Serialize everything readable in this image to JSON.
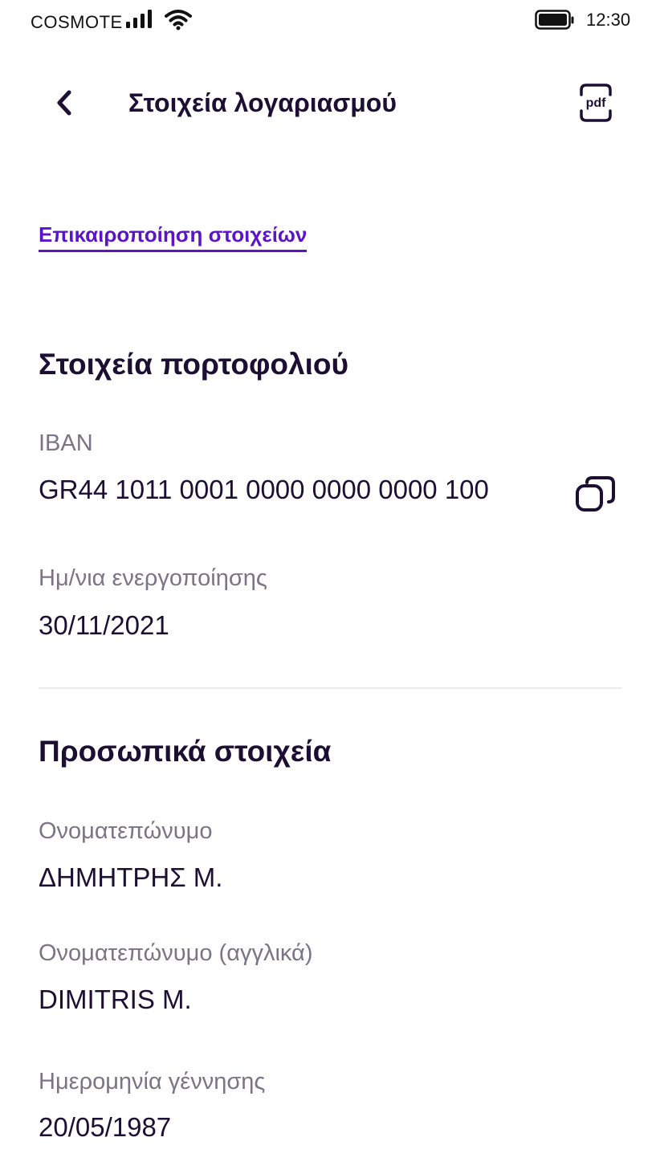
{
  "status_bar": {
    "carrier": "COSMOTE",
    "time": "12:30"
  },
  "header": {
    "title": "Στοιχεία λογαριασμού",
    "pdf_label": "pdf"
  },
  "update_link": "Επικαιροποίηση στοιχείων",
  "portfolio": {
    "title": "Στοιχεία πορτοφολιού",
    "iban_label": "IBAN",
    "iban_value": "GR44 1011 0001 0000 0000 0000 100",
    "activation_label": "Ημ/νια ενεργοποίησης",
    "activation_value": "30/11/2021"
  },
  "personal": {
    "title": "Προσωπικά στοιχεία",
    "name_label": "Ονοματεπώνυμο",
    "name_value": "ΔΗΜΗΤΡΗΣ Μ.",
    "name_en_label": "Ονοματεπώνυμο (αγγλικά)",
    "name_en_value": "DIMITRIS M.",
    "birthdate_label": "Ημερομηνία γέννησης",
    "birthdate_value": "20/05/1987"
  },
  "colors": {
    "primary_text": "#1c0f33",
    "accent": "#5b14c9",
    "secondary_text": "#7c7385",
    "divider": "#ebe8ee"
  },
  "icons": {
    "back": "chevron-left-icon",
    "pdf": "pdf-icon",
    "copy": "copy-icon",
    "signal": "signal-icon",
    "wifi": "wifi-icon",
    "battery": "battery-icon"
  }
}
